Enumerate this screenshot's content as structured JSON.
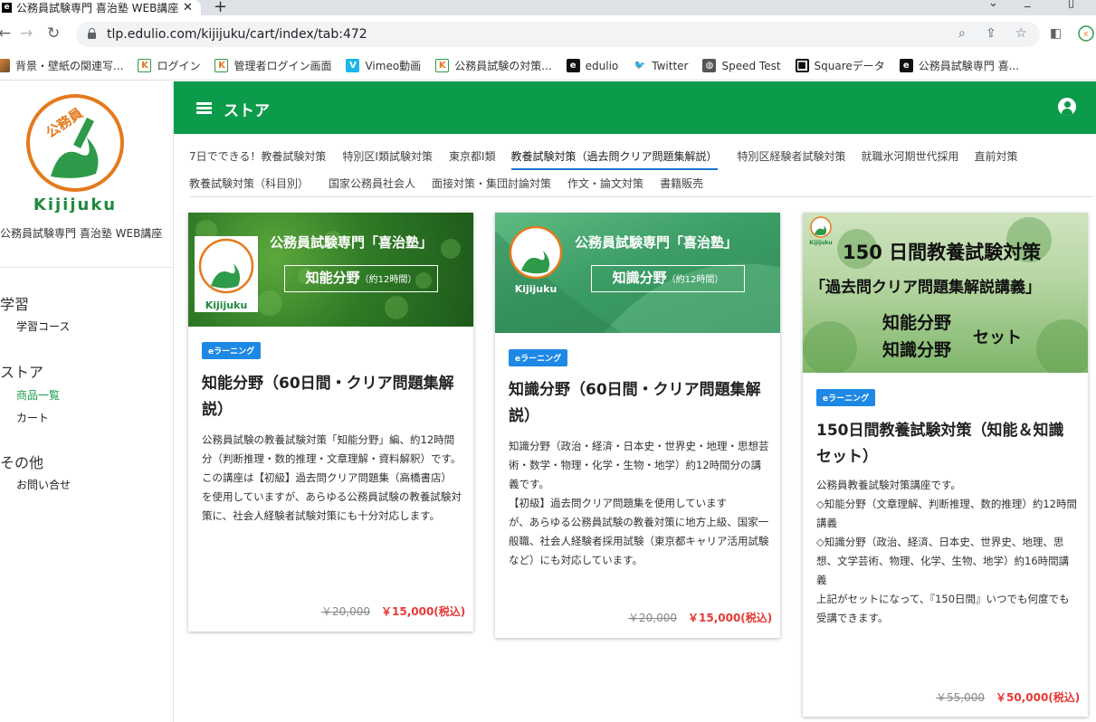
{
  "browser": {
    "tab_favicon": "e",
    "tab_title": "公務員試験専門 喜治塾 WEB講座",
    "tab_close": "✕",
    "new_tab": "+",
    "url": "tlp.edulio.com/kijijuku/cart/index/tab:472",
    "bookmarks": [
      {
        "icon": "image-thumb-icon",
        "label": "背景・壁紙の関連写..."
      },
      {
        "icon": "kijijuku-icon",
        "label": "ログイン"
      },
      {
        "icon": "kijijuku-icon",
        "label": "管理者ログイン画面"
      },
      {
        "icon": "vimeo-icon",
        "label": "Vimeo動画"
      },
      {
        "icon": "kijijuku-icon",
        "label": "公務員試験の対策..."
      },
      {
        "icon": "edulio-icon",
        "label": "edulio"
      },
      {
        "icon": "twitter-icon",
        "label": "Twitter"
      },
      {
        "icon": "globe-icon",
        "label": "Speed Test"
      },
      {
        "icon": "square-icon",
        "label": "Squareデータ"
      },
      {
        "icon": "edulio-icon",
        "label": "公務員試験専門 喜..."
      }
    ]
  },
  "sidebar": {
    "logo_top_text": "公務員",
    "logo_text": "Kijijuku",
    "school_name": "公務員試験専門 喜治塾 WEB講座",
    "sections": [
      {
        "title": "学習",
        "items": [
          {
            "label": "学習コース",
            "active": false
          }
        ]
      },
      {
        "title": "ストア",
        "items": [
          {
            "label": "商品一覧",
            "active": true
          },
          {
            "label": "カート",
            "active": false
          }
        ]
      },
      {
        "title": "その他",
        "items": [
          {
            "label": "お問い合せ",
            "active": false
          }
        ]
      }
    ]
  },
  "header": {
    "title": "ストア"
  },
  "categories": {
    "row1": [
      "7日でできる！教養試験対策",
      "特別区Ⅰ類試験対策",
      "東京都Ⅰ類",
      "教養試験対策（過去問クリア問題集解説）",
      "特別区経験者試験対策",
      "就職氷河期世代採用",
      "直前対策"
    ],
    "row2": [
      "教養試験対策（科目別）",
      "国家公務員社会人",
      "面接対策・集団討論対策",
      "作文・論文対策",
      "書籍販売"
    ],
    "active": "教養試験対策（過去問クリア問題集解説）"
  },
  "products": [
    {
      "banner": {
        "school_line": "公務員試験専門「喜治塾」",
        "subject": "知能分野",
        "hours": "（約12時間）",
        "logo_text": "Kijijuku"
      },
      "badge": "eラーニング",
      "title": "知能分野（60日間・クリア問題集解説）",
      "description": "公務員試験の教養試験対策「知能分野」編、約12時間分（判断推理・数的推理・文章理解・資料解釈）です。\nこの講座は【初級】過去問クリア問題集（高橋書店）を使用していますが、あらゆる公務員試験の教養試験対策に、社会人経験者試験対策にも十分対応します。",
      "old_price": "￥20,000",
      "price": "￥15,000(税込)"
    },
    {
      "banner": {
        "school_line": "公務員試験専門「喜治塾」",
        "subject": "知識分野",
        "hours": "（約12時間）",
        "logo_text": "Kijijuku"
      },
      "badge": "eラーニング",
      "title": "知識分野（60日間・クリア問題集解説）",
      "description": "知識分野（政治・経済・日本史・世界史・地理・思想芸術・数学・物理・化学・生物・地学）約12時間分の講義です。\n【初級】過去問クリア問題集を使用しています\nが、あらゆる公務員試験の教養対策に地方上級、国家一般職、社会人経験者採用試験（東京都キャリア活用試験など）にも対応しています。",
      "old_price": "￥20,000",
      "price": "￥15,000(税込)"
    },
    {
      "banner": {
        "line1": "150 日間教養試験対策",
        "line2": "「過去問クリア問題集解説講義」",
        "line3": "知能分野",
        "line4": "知識分野",
        "set": "セット",
        "logo_text": "Kijijuku"
      },
      "badge": "eラーニング",
      "title": "150日間教養試験対策（知能＆知識セット）",
      "description": "公務員教養試験対策講座です。\n◇知能分野（文章理解、判断推理、数的推理）約12時間講義\n◇知識分野（政治、経済、日本史、世界史、地理、思想、文学芸術、物理、化学、生物、地学）約16時間講義\n上記がセットになって、『150日間』いつでも何度でも受講できます。",
      "old_price": "￥55,000",
      "price": "￥50,000(税込)"
    }
  ],
  "colors": {
    "brand_green": "#0b9b4b",
    "active_link_green": "#1a9a4b",
    "tab_underline": "#1976d2",
    "badge_blue": "#1e88e5",
    "price_red": "#e53935",
    "logo_orange": "#e47a1c"
  }
}
